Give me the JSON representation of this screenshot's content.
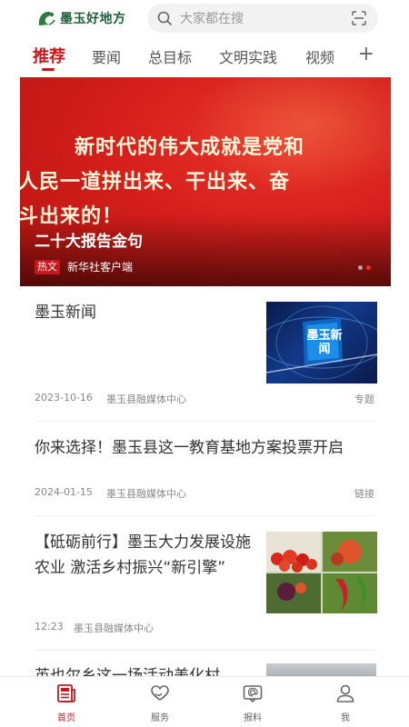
{
  "header": {
    "logo_text": "墨玉好地方",
    "search_placeholder": "大家都在搜"
  },
  "tabs": [
    {
      "label": "推荐",
      "active": true
    },
    {
      "label": "要闻"
    },
    {
      "label": "总目标"
    },
    {
      "label": "文明实践"
    },
    {
      "label": "视频"
    }
  ],
  "tab_add_label": "+",
  "banner": {
    "quote_lines": [
      "新时代的伟大成就是党和",
      "人民一道拼出来、干出来、奋",
      "斗出来的！"
    ],
    "title": "二十大报告金句",
    "tag": "热文",
    "source": "新华社客户端",
    "slides": 2,
    "active_slide": 2
  },
  "news": [
    {
      "title": "墨玉新闻",
      "date": "2023-10-16",
      "source": "墨玉县融媒体中心",
      "type": "专题",
      "thumb_text": "墨玉新闻"
    },
    {
      "title": "你来选择！墨玉县这一教育基地方案投票开启",
      "date": "2024-01-15",
      "source": "墨玉县融媒体中心",
      "type": "链接"
    },
    {
      "title": "【砥砺前行】墨玉大力发展设施农业 激活乡村振兴“新引擎”",
      "date": "12:23",
      "source": "墨玉县融媒体中心"
    },
    {
      "title": "英也尔乡这一场活动美化村"
    }
  ],
  "bottom_nav": [
    {
      "label": "首页",
      "icon": "newspaper-icon",
      "active": true
    },
    {
      "label": "服务",
      "icon": "heart-hands-icon"
    },
    {
      "label": "报料",
      "icon": "report-icon"
    },
    {
      "label": "我",
      "icon": "user-icon"
    }
  ],
  "colors": {
    "accent": "#c8161d",
    "brand_green": "#1f5e3a"
  }
}
